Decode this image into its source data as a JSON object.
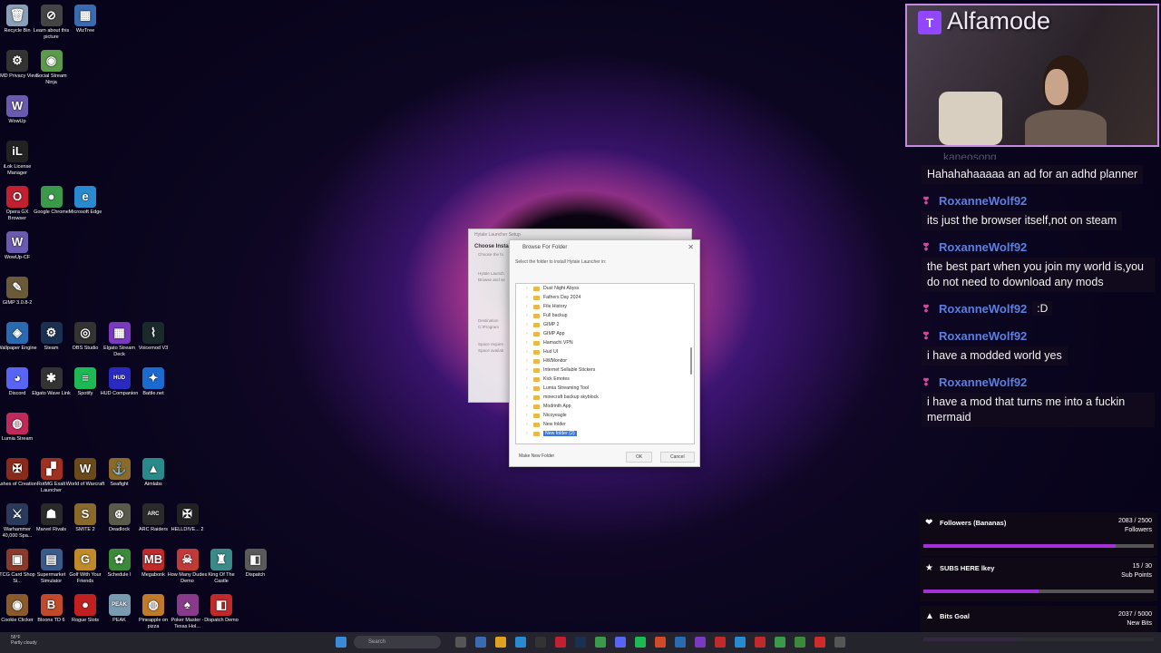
{
  "desktop_icons": [
    {
      "label": "Recycle Bin",
      "icon": "recycle-bin-icon",
      "color": "#8aa0b8",
      "glyph": "🗑"
    },
    {
      "label": "Learn about this picture",
      "icon": "camera-icon",
      "color": "#444",
      "glyph": "⊘"
    },
    {
      "label": "WizTree",
      "icon": "wiztree-icon",
      "color": "#3a6ab0",
      "glyph": "▦"
    },
    {
      "label": "AMD Privacy View",
      "icon": "amd-icon",
      "color": "#333",
      "glyph": "⚙"
    },
    {
      "label": "Social Stream Ninja",
      "icon": "ninja-icon",
      "color": "#5a9a4a",
      "glyph": "◉"
    },
    {
      "label": "WowUp",
      "icon": "wowup-icon",
      "color": "#6a5ab0",
      "glyph": "W"
    },
    {
      "label": "iLok License Manager",
      "icon": "ilok-icon",
      "color": "#222",
      "glyph": "iL"
    },
    {
      "label": "Opera GX Browser",
      "icon": "opera-icon",
      "color": "#c02030",
      "glyph": "O"
    },
    {
      "label": "Google Chrome",
      "icon": "chrome-icon",
      "color": "#3a9a4a",
      "glyph": "●"
    },
    {
      "label": "Microsoft Edge",
      "icon": "edge-icon",
      "color": "#2a8ad0",
      "glyph": "e"
    },
    {
      "label": "WowUp-CF",
      "icon": "wowup-cf-icon",
      "color": "#6a5ab0",
      "glyph": "W"
    },
    {
      "label": "GIMP 3.0.8-2",
      "icon": "gimp-icon",
      "color": "#6a5a3a",
      "glyph": "✎"
    },
    {
      "label": "Wallpaper Engine",
      "icon": "wallpaper-engine-icon",
      "color": "#2a6ab0",
      "glyph": "◈"
    },
    {
      "label": "Steam",
      "icon": "steam-icon",
      "color": "#1a3050",
      "glyph": "⚙"
    },
    {
      "label": "OBS Studio",
      "icon": "obs-icon",
      "color": "#333",
      "glyph": "◎"
    },
    {
      "label": "Elgato Stream Deck",
      "icon": "streamdeck-icon",
      "color": "#7a3ac0",
      "glyph": "▦"
    },
    {
      "label": "Voicemod V3",
      "icon": "voicemod-icon",
      "color": "#1a2a2a",
      "glyph": "⌇"
    },
    {
      "label": "Discord",
      "icon": "discord-icon",
      "color": "#5865f2",
      "glyph": "◕"
    },
    {
      "label": "Elgato Wave Link",
      "icon": "wavelink-icon",
      "color": "#333",
      "glyph": "✱"
    },
    {
      "label": "Spotify",
      "icon": "spotify-icon",
      "color": "#1db954",
      "glyph": "≡"
    },
    {
      "label": "HUD Companion",
      "icon": "hud-icon",
      "color": "#2a2ac0",
      "glyph": "HUD"
    },
    {
      "label": "Battle.net",
      "icon": "battlenet-icon",
      "color": "#1a6ad0",
      "glyph": "✦"
    },
    {
      "label": "Lumia Stream",
      "icon": "lumia-icon",
      "color": "#c02a5a",
      "glyph": "◍"
    },
    {
      "label": "Ashes of Creation",
      "icon": "ashes-icon",
      "color": "#8a2a1a",
      "glyph": "✠"
    },
    {
      "label": "RotMG Exalt Launcher",
      "icon": "rotmg-icon",
      "color": "#a03020",
      "glyph": "▞"
    },
    {
      "label": "World of Warcraft",
      "icon": "wow-icon",
      "color": "#6a4a1a",
      "glyph": "W"
    },
    {
      "label": "Seafight",
      "icon": "seafight-icon",
      "color": "#8a6a2a",
      "glyph": "⚓"
    },
    {
      "label": "Aimlabs",
      "icon": "aimlabs-icon",
      "color": "#2a8a8a",
      "glyph": "▲"
    },
    {
      "label": "Warhammer 40,000 Spa...",
      "icon": "warhammer-icon",
      "color": "#2a3a5a",
      "glyph": "⚔"
    },
    {
      "label": "Marvel Rivals",
      "icon": "marvel-icon",
      "color": "#2a2a2a",
      "glyph": "☗"
    },
    {
      "label": "SMITE 2",
      "icon": "smite-icon",
      "color": "#8a6a2a",
      "glyph": "S"
    },
    {
      "label": "Deadlock",
      "icon": "deadlock-icon",
      "color": "#5a5a4a",
      "glyph": "⊛"
    },
    {
      "label": "ARC Raiders",
      "icon": "arc-icon",
      "color": "#2a2a2a",
      "glyph": "ARC"
    },
    {
      "label": "HELLDIVE... 2",
      "icon": "helldivers-icon",
      "color": "#222",
      "glyph": "✠"
    },
    {
      "label": "TCG Card Shop Si...",
      "icon": "tcg-icon",
      "color": "#8a3a2a",
      "glyph": "▣"
    },
    {
      "label": "Supermarket Simulator",
      "icon": "supermarket-icon",
      "color": "#3a5a8a",
      "glyph": "▤"
    },
    {
      "label": "Golf With Your Friends",
      "icon": "golf-icon",
      "color": "#c08a2a",
      "glyph": "G"
    },
    {
      "label": "Schedule I",
      "icon": "schedule-icon",
      "color": "#3a8a3a",
      "glyph": "✿"
    },
    {
      "label": "Megabonk",
      "icon": "megabonk-icon",
      "color": "#c02a2a",
      "glyph": "MB"
    },
    {
      "label": "How Many Dudes Demo",
      "icon": "dudes-icon",
      "color": "#c03a3a",
      "glyph": "☠"
    },
    {
      "label": "King Of The Castle",
      "icon": "castle-icon",
      "color": "#3a8a8a",
      "glyph": "♜"
    },
    {
      "label": "Dispatch",
      "icon": "dispatch-icon",
      "color": "#5a5a5a",
      "glyph": "◧"
    },
    {
      "label": "Cookie Clicker",
      "icon": "cookie-icon",
      "color": "#8a5a2a",
      "glyph": "◉"
    },
    {
      "label": "Bloons TD 6",
      "icon": "bloons-icon",
      "color": "#c04a2a",
      "glyph": "B"
    },
    {
      "label": "Rogue Slots",
      "icon": "slots-icon",
      "color": "#c02020",
      "glyph": "●"
    },
    {
      "label": "PEAK",
      "icon": "peak-icon",
      "color": "#7a9ab0",
      "glyph": "PEAK"
    },
    {
      "label": "Pineapple on pizza",
      "icon": "pineapple-icon",
      "color": "#c07a2a",
      "glyph": "◍"
    },
    {
      "label": "Poker Master - Texas Hol...",
      "icon": "poker-icon",
      "color": "#8a3a8a",
      "glyph": "♠"
    },
    {
      "label": "Dispatch Demo",
      "icon": "dispatch-demo-icon",
      "color": "#c02a2a",
      "glyph": "◧"
    }
  ],
  "bg_dialog": {
    "title": "Hytale Launcher Setup",
    "heading": "Choose Insta",
    "sub": "Choose the fo",
    "lines": [
      "Hytale Launch",
      "Browse and se",
      "Destination",
      "C:\\Program",
      "Space require",
      "Space availab"
    ]
  },
  "browse_dialog": {
    "title": "Browse For Folder",
    "close": "✕",
    "instruction": "Select the folder to install Hytale Launcher in:",
    "folders": [
      "Dust Night Abyss",
      "Fathers Day 2024",
      "File History",
      "Full backup",
      "GIMP 2",
      "GIMP App",
      "Hamachi VPN",
      "Hud UI",
      "HWMonitor",
      "Internet Sellable Stickers",
      "Kick Emotes",
      "Lumia Streaming Tool",
      "minecraft backup skyblock",
      "Modrinth App",
      "Nicoyeagle",
      "New folder",
      "New folder (2)"
    ],
    "selected_index": 16,
    "make_new_folder": "Make New Folder",
    "ok": "OK",
    "cancel": "Cancel"
  },
  "webcam": {
    "channel_name": "Alfamode",
    "logo": "T"
  },
  "chat": {
    "partial_top": "kaneosong",
    "messages": [
      {
        "user": "",
        "text": "Hahahahaaaaa an ad for an adhd planner"
      },
      {
        "user": "RoxanneWolf92",
        "text": "its just the browser itself,not on steam"
      },
      {
        "user": "RoxanneWolf92",
        "text": "the best part when you join my world is,you do not need to download any mods"
      },
      {
        "user": "RoxanneWolf92",
        "inline": ":D"
      },
      {
        "user": "RoxanneWolf92",
        "text": "i have a modded world yes"
      },
      {
        "user": "RoxanneWolf92",
        "text": "i have a mod that turns me into a fuckin mermaid"
      }
    ]
  },
  "goals": [
    {
      "title": "Followers (Bananas)",
      "current": "2083 / 2500",
      "unit": "Followers",
      "progress": 0.833,
      "icon": "heart-icon",
      "glyph": "❤"
    },
    {
      "title": "SUBS HERE lkey",
      "current": "15 / 30",
      "unit": "Sub Points",
      "progress": 0.5,
      "icon": "star-icon",
      "glyph": "★"
    },
    {
      "title": "Bits Goal",
      "current": "2037 / 5000",
      "unit": "New Bits",
      "progress": 0.407,
      "icon": "bits-icon",
      "glyph": "▲"
    }
  ],
  "taskbar": {
    "weather_temp": "56°F",
    "weather_desc": "Partly cloudy",
    "search_placeholder": "Search"
  }
}
